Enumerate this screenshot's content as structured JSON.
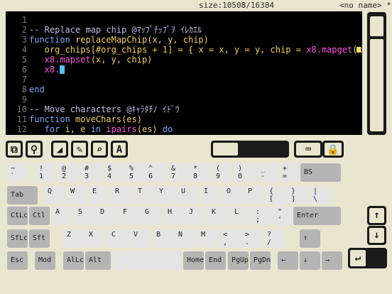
{
  "status": {
    "size": "size:10508/16384",
    "filename": "<no name> *"
  },
  "editor": {
    "lines": [
      {
        "n": "1",
        "parts": []
      },
      {
        "n": "2",
        "parts": [
          {
            "t": "-- Replace map chip @ﾏｯﾌﾟﾁｯﾌﾟｦ ｲﾚｶｴﾙ",
            "c": "c-comment"
          }
        ]
      },
      {
        "n": "3",
        "parts": [
          {
            "t": "function ",
            "c": "c-kw"
          },
          {
            "t": "replaceMapChip",
            "c": "c-fn"
          },
          {
            "t": "(x, y, chip)",
            "c": "c-id"
          }
        ]
      },
      {
        "n": "4",
        "parts": [
          {
            "t": "   org_chips[#org_chips + 1] = { x = x, y = y, chip = ",
            "c": "c-id"
          },
          {
            "t": "x8.mapget",
            "c": "c-api"
          },
          {
            "t": "(x, ",
            "c": "c-id"
          }
        ]
      },
      {
        "n": "5",
        "parts": [
          {
            "t": "   x8.mapset",
            "c": "c-api"
          },
          {
            "t": "(x, y, chip)",
            "c": "c-id"
          }
        ]
      },
      {
        "n": "6",
        "parts": [
          {
            "t": "   x8.",
            "c": "c-api"
          }
        ],
        "cursor": true
      },
      {
        "n": "7",
        "parts": []
      },
      {
        "n": "8",
        "parts": [
          {
            "t": "end",
            "c": "c-kw"
          }
        ]
      },
      {
        "n": "9",
        "parts": []
      },
      {
        "n": "10",
        "parts": [
          {
            "t": "-- Move characters @ｷｬﾗﾀﾁﾉ ｲﾄﾞｳ",
            "c": "c-comment"
          }
        ]
      },
      {
        "n": "11",
        "parts": [
          {
            "t": "function ",
            "c": "c-kw"
          },
          {
            "t": "moveChars",
            "c": "c-fn"
          },
          {
            "t": "(es)",
            "c": "c-id"
          }
        ]
      },
      {
        "n": "12",
        "parts": [
          {
            "t": "   for ",
            "c": "c-kw"
          },
          {
            "t": "i, e ",
            "c": "c-id"
          },
          {
            "t": "in ",
            "c": "c-kw"
          },
          {
            "t": "ipairs",
            "c": "c-api"
          },
          {
            "t": "(es) ",
            "c": "c-id"
          },
          {
            "t": "do",
            "c": "c-kw"
          }
        ]
      }
    ]
  },
  "toolbar": {
    "buttons": [
      {
        "name": "copy-icon",
        "glyph": "⧉"
      },
      {
        "name": "search-icon",
        "glyph": "⚲"
      },
      {
        "name": "eraser-icon",
        "glyph": "◢"
      },
      {
        "name": "pen-icon",
        "glyph": "✎"
      },
      {
        "name": "zoom-icon",
        "glyph": "⌕"
      },
      {
        "name": "font-a-icon",
        "glyph": "A"
      },
      {
        "name": "display-toggle-icon",
        "glyph": ""
      },
      {
        "name": "keyboard-icon",
        "glyph": "⌨"
      },
      {
        "name": "lock-icon",
        "glyph": "🔒"
      }
    ]
  },
  "keyboard": {
    "rows": [
      [
        {
          "top": "~",
          "bot": "`"
        },
        {
          "top": "!",
          "bot": "1"
        },
        {
          "top": "@",
          "bot": "2"
        },
        {
          "top": "#",
          "bot": "3"
        },
        {
          "top": "$",
          "bot": "4"
        },
        {
          "top": "%",
          "bot": "5"
        },
        {
          "top": "^",
          "bot": "6"
        },
        {
          "top": "&",
          "bot": "7"
        },
        {
          "top": "*",
          "bot": "8"
        },
        {
          "top": "(",
          "bot": "9"
        },
        {
          "top": ")",
          "bot": "0"
        },
        {
          "top": "_",
          "bot": "-"
        },
        {
          "top": "+",
          "bot": "="
        },
        {
          "mid": "BS"
        }
      ],
      [
        {
          "mid": "Tab"
        },
        {
          "top": "Q",
          "bot": ""
        },
        {
          "top": "W",
          "bot": ""
        },
        {
          "top": "E",
          "bot": ""
        },
        {
          "top": "R",
          "bot": ""
        },
        {
          "top": "T",
          "bot": ""
        },
        {
          "top": "Y",
          "bot": ""
        },
        {
          "top": "U",
          "bot": ""
        },
        {
          "top": "I",
          "bot": ""
        },
        {
          "top": "O",
          "bot": ""
        },
        {
          "top": "P",
          "bot": ""
        },
        {
          "top": "{",
          "bot": "["
        },
        {
          "top": "}",
          "bot": "]"
        },
        {
          "top": "|",
          "bot": "\\"
        }
      ],
      [
        {
          "mid": "CtLc"
        },
        {
          "mid": "Ctl"
        },
        {
          "top": "A",
          "bot": ""
        },
        {
          "top": "S",
          "bot": ""
        },
        {
          "top": "D",
          "bot": ""
        },
        {
          "top": "F",
          "bot": ""
        },
        {
          "top": "G",
          "bot": ""
        },
        {
          "top": "H",
          "bot": ""
        },
        {
          "top": "J",
          "bot": ""
        },
        {
          "top": "K",
          "bot": ""
        },
        {
          "top": "L",
          "bot": ""
        },
        {
          "top": ":",
          "bot": ";"
        },
        {
          "top": "\"",
          "bot": "'"
        },
        {
          "mid": "Enter"
        }
      ],
      [
        {
          "mid": "SfLc"
        },
        {
          "mid": "Sft"
        },
        {
          "top": "Z",
          "bot": ""
        },
        {
          "top": "X",
          "bot": ""
        },
        {
          "top": "C",
          "bot": ""
        },
        {
          "top": "V",
          "bot": ""
        },
        {
          "top": "B",
          "bot": ""
        },
        {
          "top": "N",
          "bot": ""
        },
        {
          "top": "M",
          "bot": ""
        },
        {
          "top": "<",
          "bot": ","
        },
        {
          "top": ">",
          "bot": "."
        },
        {
          "top": "?",
          "bot": "/"
        },
        {
          "mid": "↑"
        }
      ],
      [
        {
          "mid": "Esc"
        },
        {
          "mid": "Mod"
        },
        {
          "mid": "AlLc"
        },
        {
          "mid": "Alt"
        },
        {
          "mid": ""
        },
        {
          "mid": "Home"
        },
        {
          "mid": "End"
        },
        {
          "mid": "PgUp"
        },
        {
          "mid": "PgDn"
        },
        {
          "mid": "←"
        },
        {
          "mid": "↓"
        },
        {
          "mid": "→"
        }
      ]
    ]
  },
  "side_buttons": {
    "scroll_up": "↑",
    "scroll_down": "↓",
    "enter": "↵"
  }
}
